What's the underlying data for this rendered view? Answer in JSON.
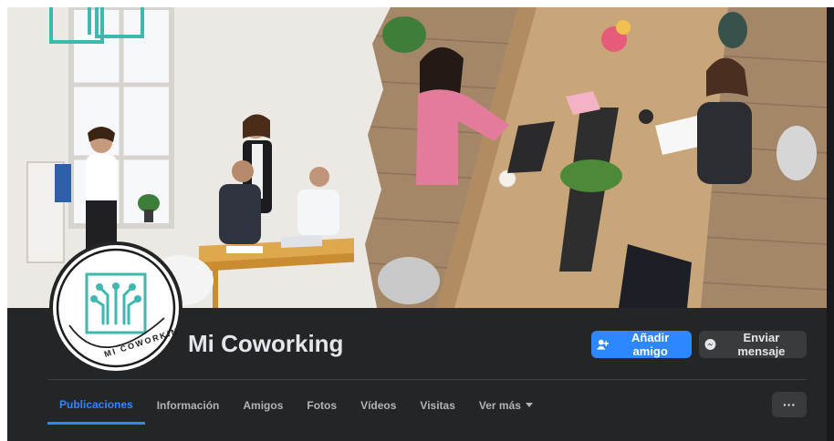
{
  "page": {
    "name": "Mi Coworking",
    "logo_text": "MI COWORKING"
  },
  "actions": {
    "add_friend_label": "Añadir amigo",
    "message_label": "Enviar mensaje",
    "more_label": "···"
  },
  "tabs": [
    {
      "label": "Publicaciones",
      "active": true
    },
    {
      "label": "Información"
    },
    {
      "label": "Amigos"
    },
    {
      "label": "Fotos"
    },
    {
      "label": "Vídeos"
    },
    {
      "label": "Visitas"
    },
    {
      "label": "Ver más",
      "has_dropdown": true
    }
  ],
  "colors": {
    "accent": "#2d88ff",
    "background": "#18191a",
    "surface": "#242526",
    "secondary_button": "#3a3b3c",
    "text_primary": "#e4e6eb",
    "text_secondary": "#b0b3b8",
    "logo_teal": "#3fb8b0"
  },
  "icons": {
    "add_friend": "person-plus-icon",
    "message": "messenger-icon",
    "dropdown": "caret-down-icon",
    "more": "ellipsis-icon"
  }
}
